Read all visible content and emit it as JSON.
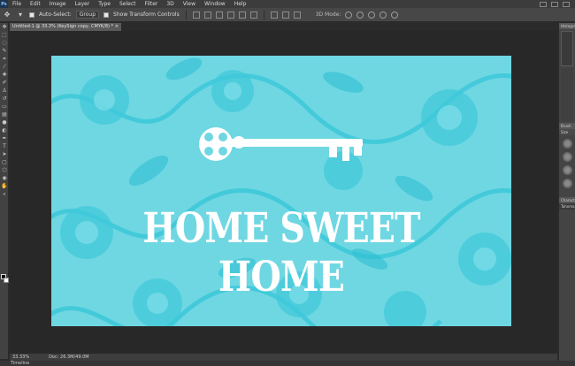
{
  "app": {
    "logo": "Ps"
  },
  "menu": [
    "File",
    "Edit",
    "Image",
    "Layer",
    "Type",
    "Select",
    "Filter",
    "3D",
    "View",
    "Window",
    "Help"
  ],
  "options": {
    "auto_select_label": "Auto-Select:",
    "auto_select_value": "Group",
    "show_transform_label": "Show Transform Controls",
    "mode_3d_label": "3D Mode:"
  },
  "document": {
    "tab_title": "Untitled-1 @ 33.3% (KeySign copy, CMYK/8) *",
    "close": "×"
  },
  "canvas": {
    "title": "HOME SWEET HOME",
    "background_color": "#6fd7e2",
    "pattern_color": "#34c4d6",
    "key_color": "#ffffff"
  },
  "status": {
    "zoom": "33.33%",
    "doc_info": "Doc: 26.3M/49.0M"
  },
  "timeline": {
    "label": "Timeline"
  },
  "panels": {
    "histogram": "Histogram",
    "brush": "Brush",
    "size": "Size",
    "character": "Character",
    "font": "Tahoma"
  }
}
